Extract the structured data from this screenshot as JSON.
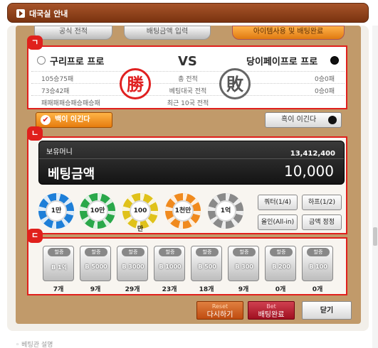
{
  "title": "대국실 안내",
  "tabs": [
    "공식 전적",
    "배팅금액 입력",
    "아이템사용 및 배팅완료"
  ],
  "match": {
    "white_player": "구리프로 프로",
    "black_player": "당이페이프로 프로",
    "vs": "VS",
    "stats": [
      {
        "left": "105승75패",
        "label": "총 전적",
        "right": "0승0패"
      },
      {
        "left": "73승42패",
        "label": "베팅대국 전적",
        "right": "0승0패"
      },
      {
        "left": "패패패패승패승패승패",
        "label": "최근 10국 전적",
        "right": ""
      }
    ],
    "win_stamp": "勝",
    "lose_stamp": "敗"
  },
  "bet_buttons": {
    "white_win": "백이 이긴다",
    "black_win": "흑이 이긴다"
  },
  "money": {
    "holding_label": "보유머니",
    "holding_value": "13,412,400",
    "bet_label": "베팅금액",
    "bet_value": "10,000"
  },
  "chips": [
    {
      "label": "1만",
      "color": "#1e7fd8"
    },
    {
      "label": "10만",
      "color": "#2aa84a"
    },
    {
      "label": "100만",
      "color": "#e0c21a"
    },
    {
      "label": "1천만",
      "color": "#f08a1e"
    },
    {
      "label": "1억",
      "color": "#8a8a8a"
    }
  ],
  "side_buttons": {
    "quarter": "쿼터(1/4)",
    "half": "하프(1/2)",
    "allin": "올인(All-in)",
    "fix": "금액 정정"
  },
  "items": [
    {
      "label": "할증",
      "value": "B 1억",
      "count": "7개"
    },
    {
      "label": "할증",
      "value": "B 5000",
      "count": "9개"
    },
    {
      "label": "할증",
      "value": "B 3000",
      "count": "29개"
    },
    {
      "label": "할증",
      "value": "B 1000",
      "count": "23개"
    },
    {
      "label": "할증",
      "value": "B 500",
      "count": "18개"
    },
    {
      "label": "할증",
      "value": "B 300",
      "count": "9개"
    },
    {
      "label": "할증",
      "value": "B 200",
      "count": "0개"
    },
    {
      "label": "할증",
      "value": "B 100",
      "count": "0개"
    }
  ],
  "section_badges": [
    "ㄱ",
    "ㄴ",
    "ㄷ"
  ],
  "footer": {
    "reset_en": "Reset",
    "reset_ko": "다시하기",
    "bet_en": "Bet",
    "bet_ko": "배팅완료",
    "close": "닫기"
  },
  "bottom_text": "◦ 베팅관 설명"
}
